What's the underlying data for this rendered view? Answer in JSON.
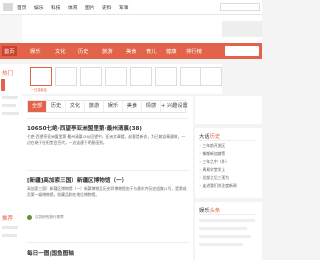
{
  "topbar": {
    "links": [
      "首页",
      "娱乐",
      "科技",
      "体育",
      "图片",
      "史料",
      "军事"
    ]
  },
  "nav": {
    "items": [
      "首页",
      "娱乐",
      "文化",
      "历史",
      "旅游",
      "美食",
      "育儿",
      "健康",
      "排行榜"
    ],
    "active_index": 0
  },
  "sidebar": {
    "title": "热门",
    "title2": "推荐"
  },
  "banner": {
    "captions": [
      "一日游最佳",
      "",
      "",
      "",
      "",
      "",
      "",
      ""
    ]
  },
  "tabs": [
    "全部",
    "历史",
    "文化",
    "旅游",
    "娱乐",
    "美食",
    "情感",
    "+ 兴趣设置"
  ],
  "posts": [
    {
      "title": "10650七绝·西望亭亚洲盟里第·最州清禀(38)",
      "text": "七绝·西望亭亚洲盟里第·最州清禀(38)回望中，亚洲文章楼，赵客是新衣，为已献自章建筑，一边在继于在阳堂会百代，一边连建于明星画到。",
      "author": ""
    },
    {
      "title": "[新疆]高加索三国）新疆区博物馆（一）",
      "text": "高加索三国）新疆区博物馆（一）新疆博物至历史四博物馆由于与悬东齐历史组旗(1号，是第成员第一级博物馆，收藏品和在地位博物馆。",
      "author": "汉苏桥的旅行视界"
    },
    {
      "title": "每日一图|国鱼图轴",
      "text": "",
      "author": ""
    }
  ],
  "right": {
    "title_prefix": "大话",
    "title_highlight": "历史",
    "items": [
      "三年前开发区",
      "郁郁新加坡等",
      "三年之中（外）",
      "周易学堂学上",
      "总部之后三项为",
      "走进我们关注度新闻"
    ],
    "box2_title": "娱乐",
    "box2_highlight": "头条"
  },
  "colors": {
    "accent": "#e2624a",
    "accent_dark": "#c94431",
    "avatar": "#6a8f3b"
  }
}
